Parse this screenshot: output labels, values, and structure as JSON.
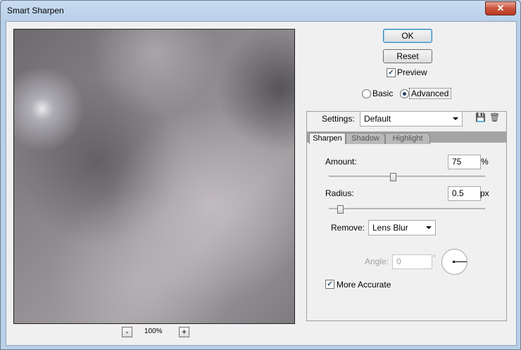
{
  "window": {
    "title": "Smart Sharpen",
    "close_glyph": "✕"
  },
  "buttons": {
    "ok": "OK",
    "reset": "Reset"
  },
  "preview_option": {
    "label": "Preview",
    "checked": true
  },
  "mode": {
    "basic": "Basic",
    "advanced": "Advanced",
    "selected": "Advanced"
  },
  "settings": {
    "label": "Settings:",
    "value": "Default"
  },
  "tabs": [
    {
      "label": "Sharpen",
      "active": true
    },
    {
      "label": "Shadow",
      "active": false
    },
    {
      "label": "Highlight",
      "active": false
    }
  ],
  "amount": {
    "label": "Amount:",
    "value": "75",
    "unit": "%",
    "slider_fraction": 0.41
  },
  "radius": {
    "label": "Radius:",
    "value": "0.5",
    "unit": "px",
    "slider_fraction": 0.07
  },
  "remove": {
    "label": "Remove:",
    "value": "Lens Blur"
  },
  "angle": {
    "label": "Angle:",
    "value": "0",
    "unit": "°"
  },
  "more_accurate": {
    "label": "More Accurate",
    "checked": true
  },
  "zoom": {
    "minus": "-",
    "level": "100%",
    "plus": "+"
  },
  "icons": {
    "save": "save-settings-icon",
    "delete": "trash-icon",
    "check": "✓"
  }
}
